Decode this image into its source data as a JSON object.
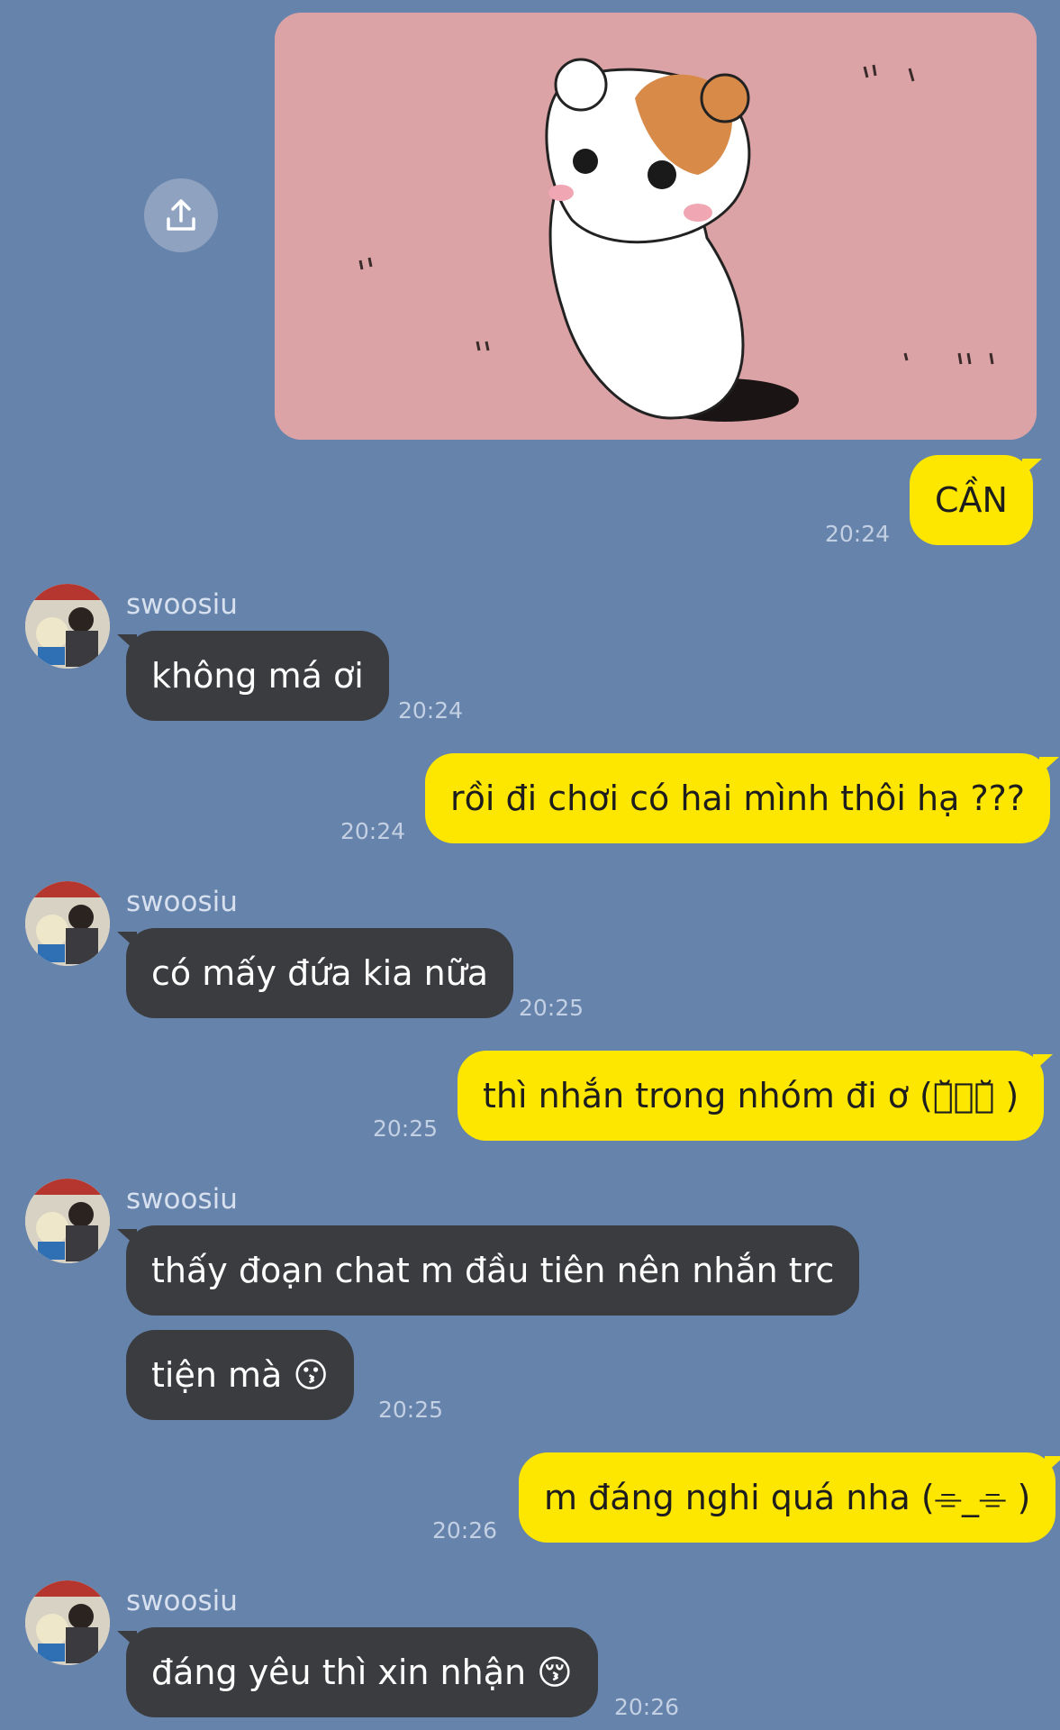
{
  "image_message": {
    "alt": "hamster sticker image"
  },
  "share_button": {
    "icon": "share-icon"
  },
  "messages": [
    {
      "from": "me",
      "text": "CẦN",
      "time": "20:24"
    },
    {
      "from": "them",
      "sender": "swoosiu",
      "text": "không má ơi",
      "time": "20:24"
    },
    {
      "from": "me",
      "text": "rồi đi chơi có hai mình thôi hạ ???",
      "time": "20:24"
    },
    {
      "from": "them",
      "sender": "swoosiu",
      "text": "có mấy đứa kia nữa",
      "time": "20:25"
    },
    {
      "from": "me",
      "text": "thì nhắn trong nhóm đi ơ (･̆⍛･̆ )",
      "time": "20:25"
    },
    {
      "from": "them",
      "sender": "swoosiu",
      "text": "thấy đoạn chat m đầu tiên nên nhắn trc"
    },
    {
      "from": "them",
      "text": "tiện mà 😗",
      "time": "20:25"
    },
    {
      "from": "me",
      "text": "m đáng nghi quá nha (⌯_⌯ )",
      "time": "20:26"
    },
    {
      "from": "them",
      "sender": "swoosiu",
      "text": "đáng yêu thì xin nhận 😚",
      "time": "20:26"
    }
  ]
}
